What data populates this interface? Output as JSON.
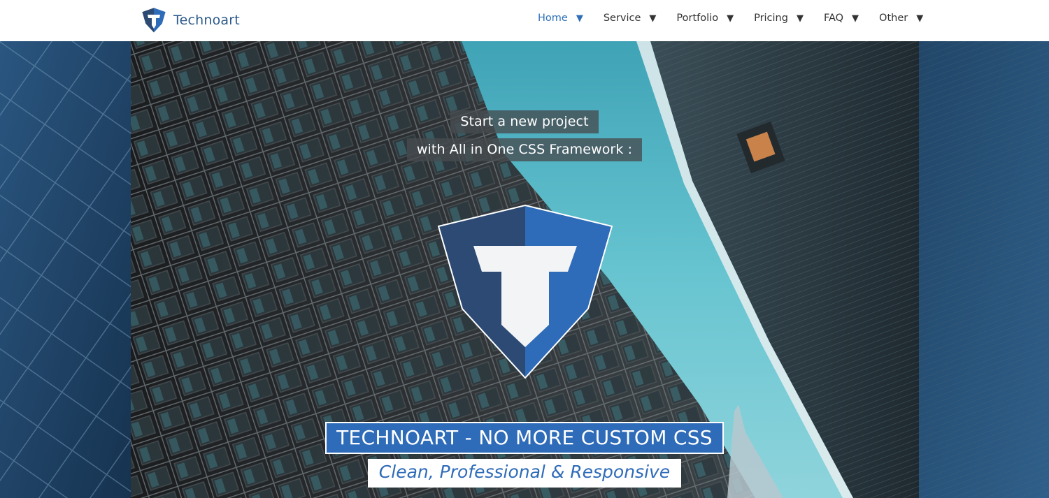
{
  "navbar": {
    "brand_name": "Technoart",
    "brand_icon": "shield-t-logo-icon",
    "items": [
      {
        "label": "Home",
        "active": true
      },
      {
        "label": "Service",
        "active": false
      },
      {
        "label": "Portfolio",
        "active": false
      },
      {
        "label": "Pricing",
        "active": false
      },
      {
        "label": "FAQ",
        "active": false
      },
      {
        "label": "Other",
        "active": false
      }
    ],
    "caret_icon": "caret-down-icon",
    "caret_glyph": "▼"
  },
  "hero": {
    "tagline_line1": "Start a new project",
    "tagline_line2": "with All in One CSS Framework :",
    "logo_icon": "shield-t-logo-icon",
    "title": "TECHNOART - NO MORE CUSTOM CSS",
    "subtitle": "Clean, Professional & Responsive",
    "background": "building-facade-sky-photo"
  },
  "colors": {
    "brand_blue": "#2e6bb8",
    "brand_dark_blue": "#2c4a73",
    "nav_active": "#2e6fb8",
    "nav_text": "#333333",
    "sky": "#5bbfca"
  }
}
